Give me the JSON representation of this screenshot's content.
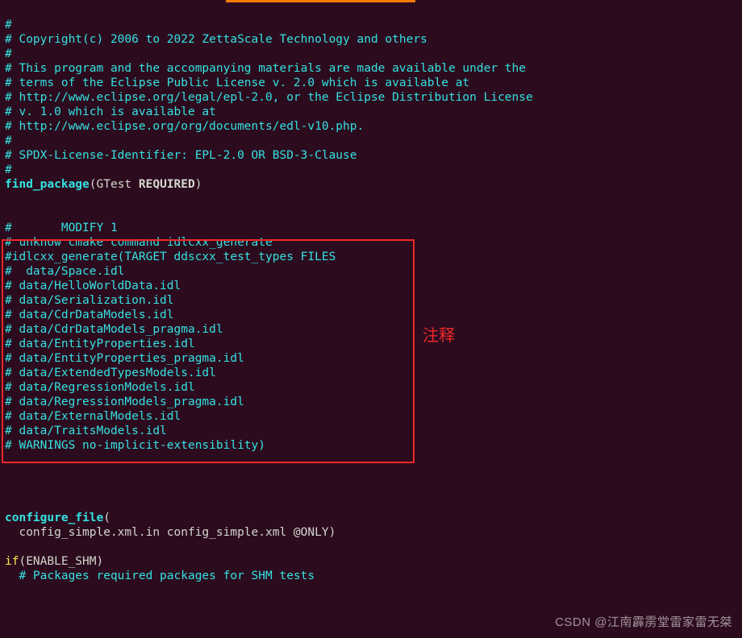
{
  "lines": {
    "l0": "#",
    "l1": "# Copyright(c) 2006 to 2022 ZettaScale Technology and others",
    "l2": "#",
    "l3": "# This program and the accompanying materials are made available under the",
    "l4": "# terms of the Eclipse Public License v. 2.0 which is available at",
    "l5": "# http://www.eclipse.org/legal/epl-2.0, or the Eclipse Distribution License",
    "l6": "# v. 1.0 which is available at",
    "l7": "# http://www.eclipse.org/org/documents/edl-v10.php.",
    "l8": "#",
    "l9": "# SPDX-License-Identifier: EPL-2.0 OR BSD-3-Clause",
    "l10": "#",
    "fp_kw": "find_package",
    "fp_open": "(",
    "fp_arg1": "GTest ",
    "fp_req": "REQUIRED",
    "fp_close": ")",
    "m1": "#       MODIFY 1",
    "m2": "# unknow cmake command idlcxx_generate",
    "b0": "#idlcxx_generate(TARGET ddscxx_test_types FILES",
    "b1": "#  data/Space.idl",
    "b2": "# data/HelloWorldData.idl",
    "b3": "# data/Serialization.idl",
    "b4": "# data/CdrDataModels.idl",
    "b5": "# data/CdrDataModels_pragma.idl",
    "b6": "# data/EntityProperties.idl",
    "b7": "# data/EntityProperties_pragma.idl",
    "b8": "# data/ExtendedTypesModels.idl",
    "b9": "# data/RegressionModels.idl",
    "b10": "# data/RegressionModels_pragma.idl",
    "b11": "# data/ExternalModels.idl",
    "b12": "# data/TraitsModels.idl",
    "b13": "# WARNINGS no-implicit-extensibility)",
    "cf_kw": "configure_file",
    "cf_open": "(",
    "cf_args": "  config_simple.xml.in config_simple.xml @ONLY",
    "cf_close": ")",
    "if_kw": "if",
    "if_open": "(",
    "if_cond": "ENABLE_SHM",
    "if_close": ")",
    "pkg_comment": "  # Packages required packages for SHM tests"
  },
  "annotation": "注释",
  "watermark": "CSDN @江南霹雳堂雷家雷无桀"
}
